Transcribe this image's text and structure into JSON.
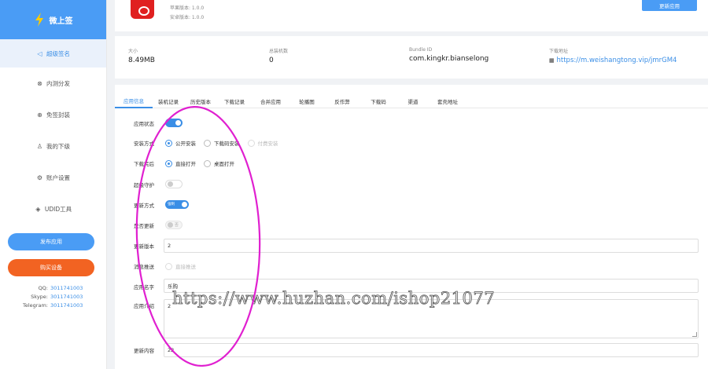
{
  "brand": {
    "name": "微上签"
  },
  "sidebar": {
    "items": [
      {
        "label": "超级签名",
        "icon": "send-icon"
      },
      {
        "label": "内测分发",
        "icon": "rocket-icon"
      },
      {
        "label": "免签封装",
        "icon": "globe-icon"
      },
      {
        "label": "我的下级",
        "icon": "user-icon"
      },
      {
        "label": "账户设置",
        "icon": "settings-icon"
      },
      {
        "label": "UDID工具",
        "icon": "tag-icon"
      }
    ],
    "publish_button": "发布应用",
    "buy_button": "购买设备",
    "contacts": [
      {
        "key": "QQ:",
        "value": "3011741003"
      },
      {
        "key": "Skype:",
        "value": "3011741003"
      },
      {
        "key": "Telegram:",
        "value": "3011741003"
      }
    ]
  },
  "header": {
    "ios_version": "苹果版本: 1.0.0",
    "android_version": "安卓版本: 1.0.0",
    "more_button": "更新应用"
  },
  "stats": {
    "size_label": "大小",
    "size_value": "8.49MB",
    "installs_label": "总装机数",
    "installs_value": "0",
    "bundle_label": "Bundle ID",
    "bundle_value": "com.kingkr.bianselong",
    "download_label": "下载地址",
    "download_value": "https://m.weishangtong.vip/jmrGM4"
  },
  "tabs": [
    "应用信息",
    "装机记录",
    "历史版本",
    "下载记录",
    "合并应用",
    "轮播图",
    "反作弊",
    "下载码",
    "渠道",
    "套壳地址"
  ],
  "form": {
    "app_status_label": "应用状态",
    "install_mode_label": "安装方式",
    "install_options": [
      "公开安装",
      "下载码安装",
      "付费安装"
    ],
    "after_download_label": "下载完后",
    "after_download_options": [
      "直接打开",
      "桌面打开"
    ],
    "super_guard_label": "超级守护",
    "update_mode_label": "更新方式",
    "update_mode_toggle": "强制",
    "force_update_label": "是否更新",
    "force_update_toggle": "否",
    "update_version_label": "更新版本",
    "update_version_value": "2",
    "push_label": "消息推送",
    "push_option": "直接推送",
    "app_name_label": "应用名字",
    "app_name_value": "乐购",
    "app_intro_label": "应用介绍",
    "app_intro_value": "2",
    "update_content_label": "更新内容",
    "update_content_value": "22"
  },
  "watermark": "https://www.huzhan.com/ishop21077",
  "colors": {
    "accent": "#3a8ee6",
    "brand_blue": "#4a9cf5",
    "orange": "#f26322",
    "annotation": "#e020d0"
  }
}
